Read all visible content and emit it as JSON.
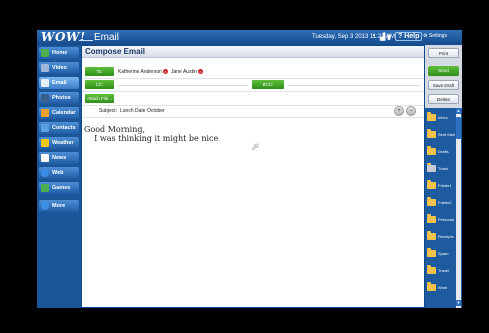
{
  "topbar": {
    "logo": "WOW!",
    "app_title": "Email",
    "datetime": "Tuesday, Sep 3 2013  11:21 AM",
    "help": "? Help",
    "settings": "⚙ Settings"
  },
  "nav": {
    "items": [
      {
        "label": "Home",
        "icon": "home-icon",
        "color": "#4caf50"
      },
      {
        "label": "Video Chat",
        "icon": "video-chat-icon",
        "color": "#9fb7d8"
      },
      {
        "label": "Email",
        "icon": "email-icon",
        "color": "#e8eef8"
      },
      {
        "label": "Photos",
        "icon": "photos-icon",
        "color": "#3a5f8f"
      },
      {
        "label": "Calendar",
        "icon": "calendar-icon",
        "color": "#f0a030"
      },
      {
        "label": "Contacts",
        "icon": "contacts-icon",
        "color": "#5aa0e0"
      },
      {
        "label": "Weather",
        "icon": "weather-icon",
        "color": "#f5c518"
      },
      {
        "label": "News",
        "icon": "news-icon",
        "color": "#ffffff"
      },
      {
        "label": "Web",
        "icon": "web-icon",
        "color": "#3a8ee6"
      },
      {
        "label": "Games",
        "icon": "games-icon",
        "color": "#4caf50"
      },
      {
        "label": "More",
        "icon": "more-icon",
        "color": "#3a8ee6"
      }
    ]
  },
  "compose": {
    "title": "Compose Email",
    "to_label": "To:",
    "recipients": [
      "Katherine Anderson",
      "Jane Austin"
    ],
    "cc_label": "CC:",
    "bcc_label": "BCC:",
    "attach_label": "Attach File...",
    "subject_label": "Subject:",
    "subject_value": "Lunch Date October",
    "body_line1": "Good Morning,",
    "body_line2": "    I was thinking it might be nice"
  },
  "actions": {
    "print": "Print",
    "send": "Send",
    "save_draft": "Save Draft",
    "delete": "Delete"
  },
  "folders": [
    "Inbox",
    "Sent Mail",
    "Drafts",
    "Trash",
    "Folder1",
    "Folder2",
    "Personal",
    "Receipts",
    "Spam",
    "Travel",
    "Work"
  ],
  "colors": {
    "accent_green": "#3aa02a",
    "nav_blue": "#1b5698",
    "folder_yellow": "#f2c24a"
  }
}
